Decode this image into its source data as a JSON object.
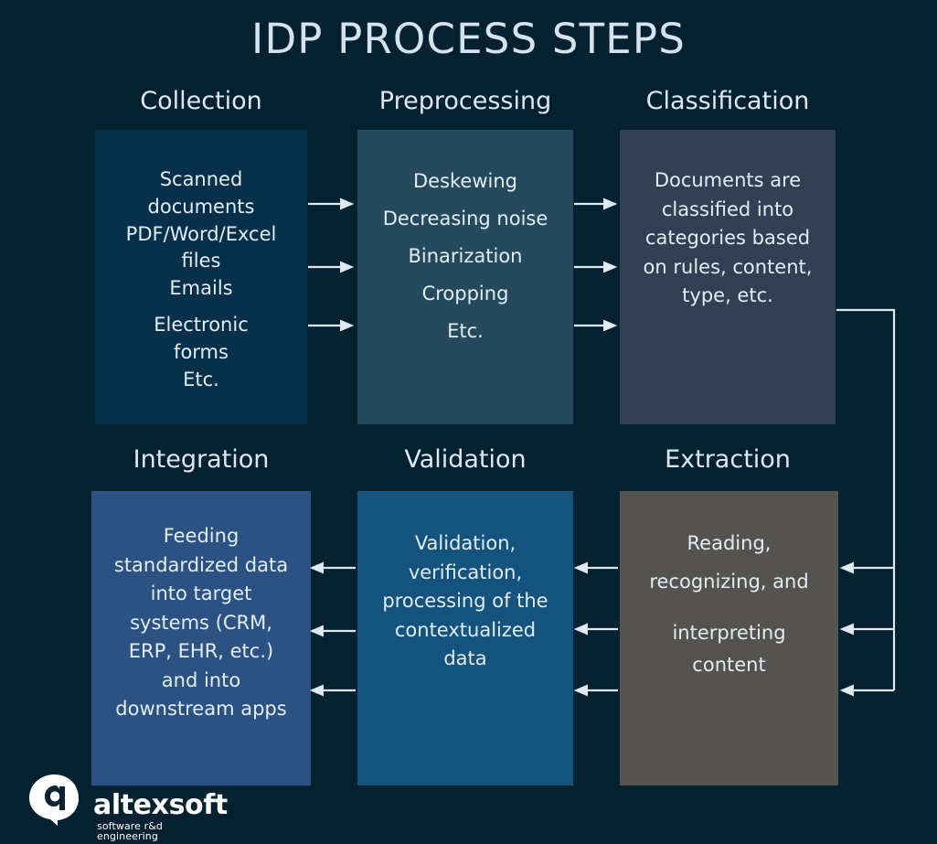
{
  "page": {
    "title": "IDP PROCESS STEPS",
    "background_color": "#04212f",
    "text_color": "#e3edf5"
  },
  "steps": [
    {
      "heading": "Collection",
      "color": "#06304a",
      "lines": [
        "Scanned",
        "documents",
        "PDF/Word/Excel",
        "files",
        "Emails",
        "Electronic",
        "forms",
        "Etc."
      ]
    },
    {
      "heading": "Preprocessing",
      "color": "#254a5e",
      "lines": [
        "Deskewing",
        "Decreasing noise",
        "Binarization",
        "Cropping",
        "Etc."
      ]
    },
    {
      "heading": "Classification",
      "color": "#333f52",
      "lines": [
        "Documents are",
        "classified into",
        "categories based",
        "on rules, content,",
        "type, etc."
      ]
    },
    {
      "heading": "Integration",
      "color": "#2b5283",
      "lines": [
        "Feeding",
        "standardized data",
        "into target",
        "systems (CRM,",
        "ERP, EHR, etc.)",
        "and into",
        "downstream apps"
      ]
    },
    {
      "heading": "Validation",
      "color": "#14537d",
      "lines": [
        "Validation,",
        "verification,",
        "processing of the",
        "contextualized",
        "data"
      ]
    },
    {
      "heading": "Extraction",
      "color": "#55534f",
      "lines": [
        "Reading,",
        "recognizing, and",
        "interpreting",
        "content"
      ]
    }
  ],
  "flow": {
    "connector_color": "#dfe9f1",
    "edges": [
      "Collection -> Preprocessing",
      "Preprocessing -> Classification",
      "Classification -> Extraction",
      "Extraction -> Validation",
      "Validation -> Integration"
    ]
  },
  "branding": {
    "wordmark": "altexsoft",
    "tagline": "software r&d engineering",
    "mark": "altexsoft-speech-bubble-logo"
  }
}
